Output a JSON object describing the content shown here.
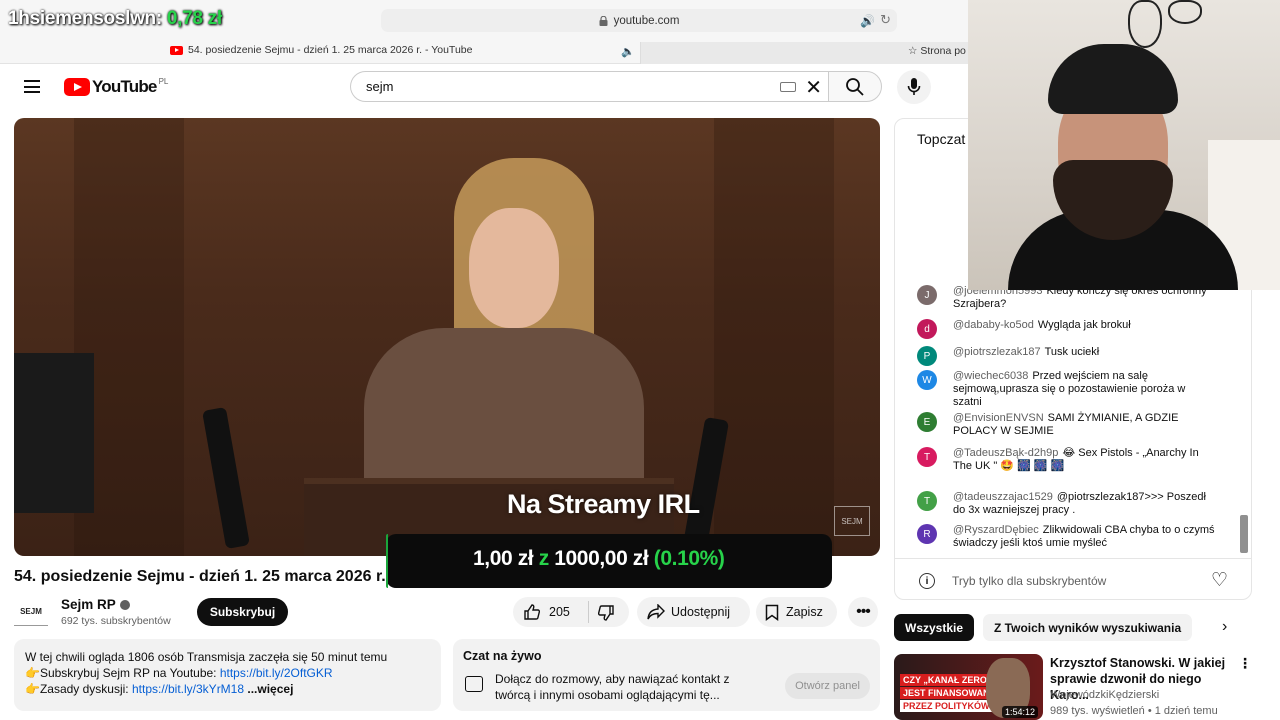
{
  "overlay": {
    "label": "1hsiemensoslwn:",
    "amount": "0,78 zł"
  },
  "browser": {
    "url": "youtube.com",
    "tab_title": "54. posiedzenie Sejmu - dzień 1. 25 marca 2026 r. - YouTube",
    "tab2_title": "Strona po"
  },
  "header": {
    "logo_text": "YouTube",
    "country_code": "PL",
    "search_value": "sejm"
  },
  "video": {
    "stream_title": "Na Streamy IRL",
    "watermark": "SEJM",
    "donation": {
      "current": "1,00 zł",
      "of": "z",
      "goal": "1000,00 zł",
      "percent": "(0.10%)",
      "fraction": 0.001
    }
  },
  "meta": {
    "title": "54. posiedzenie Sejmu - dzień 1. 25 marca 2026 r.",
    "channel_name": "Sejm RP",
    "channel_avatar": "SEJM",
    "subscribers": "692 tys. subskrybentów",
    "subscribe_label": "Subskrybuj",
    "likes": "205",
    "share_label": "Udostępnij",
    "save_label": "Zapisz"
  },
  "description": {
    "line1": "W tej chwili ogląda 1806 osób  Transmisja zaczęła się 50 minut temu",
    "line2_prefix": "👉Subskrybuj Sejm RP na Youtube: ",
    "line2_link": "https://bit.ly/2OftGKR",
    "line3_prefix": "👉Zasady dyskusji: ",
    "line3_link": "https://bit.ly/3kYrM18",
    "more": "...więcej"
  },
  "livechat_card": {
    "title": "Czat na żywo",
    "text": "Dołącz do rozmowy, aby nawiązać kontakt z twórcą i innymi osobami oglądającymi tę...",
    "button": "Otwórz panel"
  },
  "chat": {
    "header": "Topczat",
    "messages": [
      {
        "initial": "J",
        "color": "#7b6b6b",
        "author": "@joelemmon5993",
        "text": "Kiedy kończy się okres ochronny Szrajbera?"
      },
      {
        "initial": "d",
        "color": "#c2185b",
        "author": "@dababy-ko5od",
        "text": "Wygląda jak brokuł"
      },
      {
        "initial": "P",
        "color": "#00897b",
        "author": "@piotrszlezak187",
        "text": "Tusk uciekł"
      },
      {
        "initial": "W",
        "color": "#1e88e5",
        "author": "@wiechec6038",
        "text": "Przed wejściem na salę sejmową,uprasza się o pozostawienie poroża w szatni"
      },
      {
        "initial": "E",
        "color": "#2e7d32",
        "author": "@EnvisionENVSN",
        "text": "SAMI ŻYMIANIE, A GDZIE POLACY W SEJMIE"
      },
      {
        "initial": "T",
        "color": "#d81b60",
        "author": "@TadeuszBąk-d2h9p",
        "text": "😂 Sex Pistols - „Anarchy In The UK \" 🤩 🎆 🎆 🎆"
      },
      {
        "initial": "T",
        "color": "#43a047",
        "author": "@tadeuszzajac1529",
        "text": "@piotrszlezak187>>> Poszedł do 3x wazniejszej pracy ."
      },
      {
        "initial": "R",
        "color": "#5e35b1",
        "author": "@RyszardDębiec",
        "text": "Zlikwidowali CBA chyba to o czymś świadczy jeśli ktoś umie myśleć"
      }
    ],
    "input_placeholder": "Tryb tylko dla subskrybentów"
  },
  "chips": {
    "all": "Wszystkie",
    "yours": "Z Twoich wyników wyszukiwania"
  },
  "recommendation": {
    "title": "Krzysztof Stanowski. W jakiej sprawie dzwonił do niego Karo...",
    "channel": "WojewódzkiKędzierski",
    "meta": "989 tys. wyświetleń • 1 dzień temu",
    "duration": "1:54:12",
    "thumb_line1": "CZY „KANAŁ ZERO”",
    "thumb_line2": "JEST FINANSOWANY",
    "thumb_line3": "PRZEZ POLITYKÓW"
  }
}
